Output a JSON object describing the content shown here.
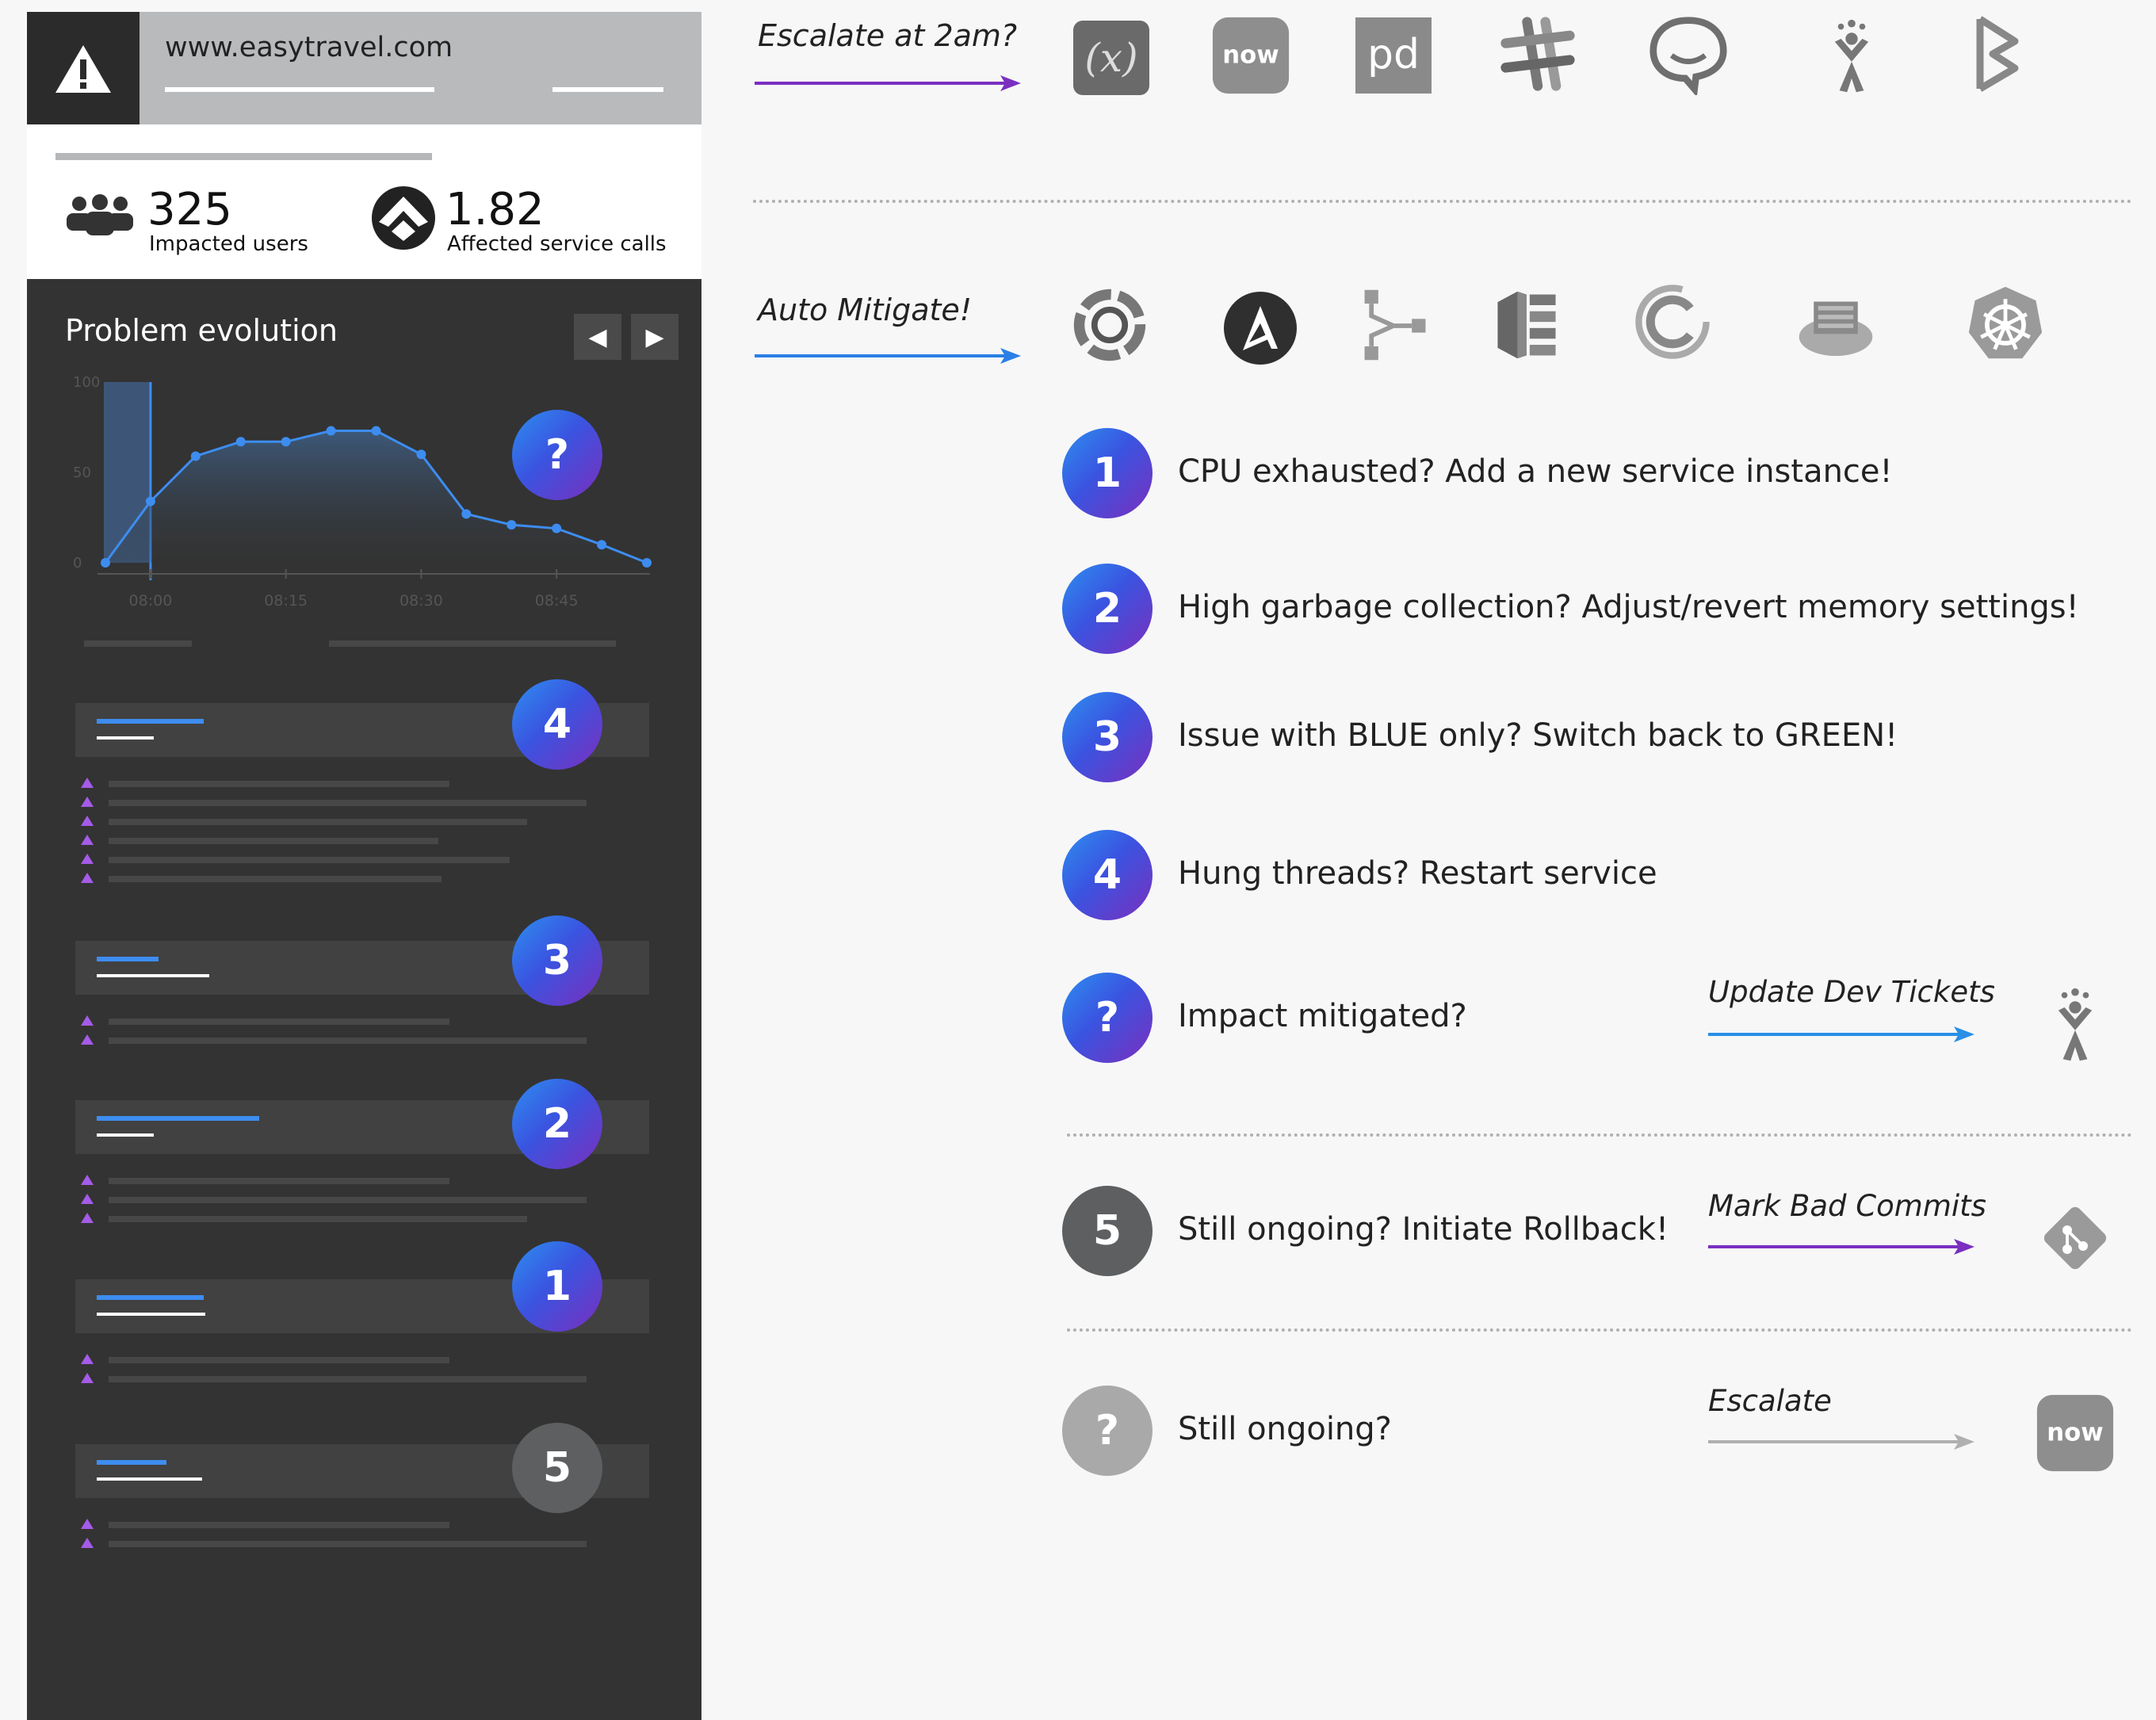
{
  "card": {
    "site": "www.easytravel.com",
    "users_value": "325",
    "users_label": "Impacted users",
    "calls_value": "1.82",
    "calls_label": "Affected service calls",
    "evolution_title": "Problem evolution",
    "prev_glyph": "◀",
    "next_glyph": "▶",
    "events": [
      {
        "badge": "4"
      },
      {
        "badge": "3"
      },
      {
        "badge": "2"
      },
      {
        "badge": "1"
      },
      {
        "badge": "5"
      }
    ],
    "chart_badge": "?"
  },
  "chart_data": {
    "type": "area",
    "x": [
      "07:53",
      "08:00",
      "08:05",
      "08:10",
      "08:15",
      "08:20",
      "08:25",
      "08:30",
      "08:35",
      "08:40",
      "08:45",
      "08:50",
      "08:55"
    ],
    "values": [
      0,
      34,
      59,
      67,
      67,
      73,
      73,
      60,
      27,
      21,
      19,
      10,
      0
    ],
    "xticks": [
      "08:00",
      "08:15",
      "08:30",
      "08:45"
    ],
    "yticks": [
      "100",
      "50",
      "0"
    ],
    "ylim": [
      0,
      100
    ],
    "highlight_range": [
      "07:53",
      "08:00"
    ]
  },
  "right": {
    "escalate_label": "Escalate at 2am?",
    "auto_label": "Auto Mitigate!",
    "escalate_logos": [
      "xmatters-icon",
      "servicenow-icon",
      "pagerduty-icon",
      "slack-icon",
      "hipchat-icon",
      "jira-icon",
      "stackstorm-icon"
    ],
    "auto_logos": [
      "spinnaker-icon",
      "ansible-icon",
      "cloud-function-icon",
      "aws-icon",
      "chef-icon",
      "ibm-cloud-icon",
      "kubernetes-icon"
    ],
    "steps": [
      {
        "badge": "1",
        "text": "CPU exhausted? Add a new service instance!"
      },
      {
        "badge": "2",
        "text": "High garbage collection? Adjust/revert memory settings!"
      },
      {
        "badge": "3",
        "text": "Issue with BLUE only? Switch back to GREEN!"
      },
      {
        "badge": "4",
        "text": "Hung threads? Restart service"
      },
      {
        "badge": "?",
        "text": "Impact mitigated?"
      },
      {
        "badge": "5",
        "text": "Still ongoing? Initiate Rollback!"
      },
      {
        "badge": "?",
        "text": "Still ongoing?"
      }
    ],
    "update_label": "Update Dev Tickets",
    "mark_label": "Mark Bad Commits",
    "escalate2_label": "Escalate",
    "now_text": "now",
    "pd_text": "pd",
    "x_text": "(x)"
  },
  "colors": {
    "purple": "#7a2fc0",
    "blue": "#2a7fe6",
    "grey_arrow": "#b0b0b0",
    "chart_line": "#3d8df0",
    "dark_panel": "#333333"
  }
}
